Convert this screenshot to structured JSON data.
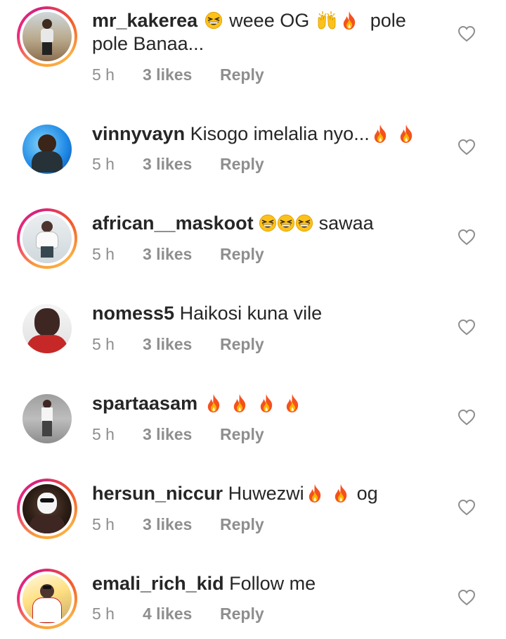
{
  "comments": [
    {
      "username": "mr_kakerea",
      "text_parts": [
        "weee OG",
        "pole pole Banaa..."
      ],
      "time": "5 h",
      "likes": "3 likes",
      "reply": "Reply",
      "story_ring": true
    },
    {
      "username": "vinnyvayn",
      "text": "Kisogo imelalia nyo...",
      "time": "5 h",
      "likes": "3 likes",
      "reply": "Reply",
      "story_ring": false
    },
    {
      "username": "african__maskoot",
      "text": "sawaa",
      "time": "5 h",
      "likes": "3 likes",
      "reply": "Reply",
      "story_ring": true
    },
    {
      "username": "nomess5",
      "text": "Haikosi kuna vile",
      "time": "5 h",
      "likes": "3 likes",
      "reply": "Reply",
      "story_ring": false
    },
    {
      "username": "spartaasam",
      "text": "",
      "time": "5 h",
      "likes": "3 likes",
      "reply": "Reply",
      "story_ring": false
    },
    {
      "username": "hersun_niccur",
      "text_parts": [
        "Huwezwi",
        "og"
      ],
      "time": "5 h",
      "likes": "3 likes",
      "reply": "Reply",
      "story_ring": true
    },
    {
      "username": "emali_rich_kid",
      "text": "Follow me",
      "time": "5 h",
      "likes": "4 likes",
      "reply": "Reply",
      "story_ring": true
    }
  ],
  "icons": {
    "like": "heart-outline-icon",
    "fire": "fire-emoji",
    "grin": "grinning-squinting-emoji",
    "hands": "raised-hands-emoji"
  },
  "colors": {
    "text": "#262626",
    "meta": "#8e8e8e",
    "story_ring_start": "#f9a23a",
    "story_ring_end": "#ee2a7b"
  }
}
